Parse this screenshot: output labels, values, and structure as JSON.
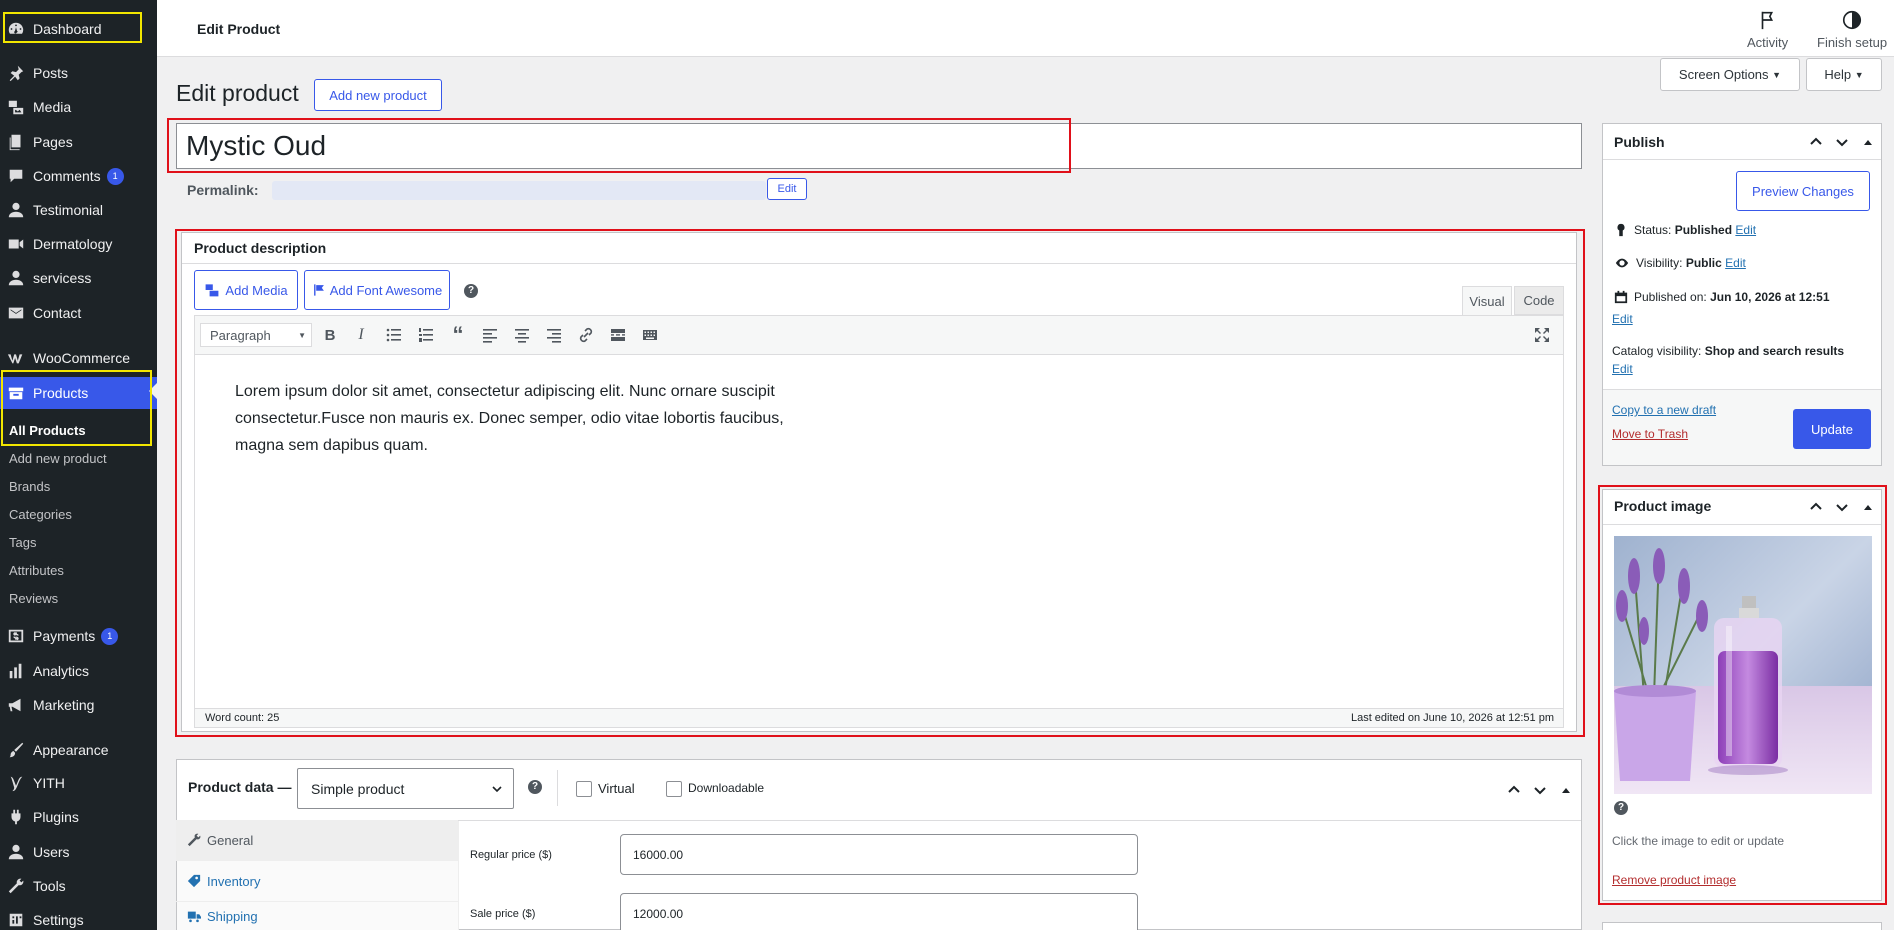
{
  "sidebar": {
    "items": [
      {
        "label": "Dashboard",
        "icon": "dashboard-icon"
      },
      {
        "label": "Posts",
        "icon": "pin-icon"
      },
      {
        "label": "Media",
        "icon": "media-icon"
      },
      {
        "label": "Pages",
        "icon": "pages-icon"
      },
      {
        "label": "Comments",
        "icon": "comment-icon",
        "badge": "1"
      },
      {
        "label": "Testimonial",
        "icon": "user-icon"
      },
      {
        "label": "Dermatology",
        "icon": "video-icon"
      },
      {
        "label": "servicess",
        "icon": "user-icon"
      },
      {
        "label": "Contact",
        "icon": "mail-icon"
      },
      {
        "label": "WooCommerce",
        "icon": "woo-icon"
      },
      {
        "label": "Products",
        "icon": "archive-icon"
      },
      {
        "label": "Payments",
        "icon": "dollar-icon",
        "badge": "1"
      },
      {
        "label": "Analytics",
        "icon": "bar-chart-icon"
      },
      {
        "label": "Marketing",
        "icon": "megaphone-icon"
      },
      {
        "label": "Appearance",
        "icon": "brush-icon"
      },
      {
        "label": "YITH",
        "icon": "yith-icon"
      },
      {
        "label": "Plugins",
        "icon": "plugin-icon"
      },
      {
        "label": "Users",
        "icon": "user-icon"
      },
      {
        "label": "Tools",
        "icon": "wrench-icon"
      },
      {
        "label": "Settings",
        "icon": "settings-icon"
      }
    ],
    "submenu": [
      "All Products",
      "Add new product",
      "Brands",
      "Categories",
      "Tags",
      "Attributes",
      "Reviews"
    ]
  },
  "topbar": {
    "page_header": "Edit Product",
    "activity": "Activity",
    "finish_setup": "Finish setup",
    "screen_options": "Screen Options",
    "help": "Help"
  },
  "main": {
    "heading": "Edit product",
    "add_new": "Add new product",
    "title_value": "Mystic Oud",
    "permalink_label": "Permalink:",
    "permalink_edit": "Edit"
  },
  "editor": {
    "box_title": "Product description",
    "add_media": "Add Media",
    "add_font_awesome": "Add Font Awesome",
    "tab_visual": "Visual",
    "tab_code": "Code",
    "format_select": "Paragraph",
    "content": "Lorem ipsum dolor sit amet, consectetur adipiscing elit. Nunc ornare suscipit consectetur.Fusce non mauris ex. Donec semper, odio vitae lobortis faucibus, magna sem dapibus quam.",
    "word_count": "Word count: 25",
    "last_edited": "Last edited on June 10, 2026 at 12:51 pm"
  },
  "publish": {
    "title": "Publish",
    "preview": "Preview Changes",
    "status_label": "Status:",
    "status_value": "Published",
    "visibility_label": "Visibility:",
    "visibility_value": "Public",
    "published_label": "Published on:",
    "published_value": "Jun 10, 2026 at 12:51",
    "catalog_label": "Catalog visibility:",
    "catalog_value": "Shop and search results",
    "edit": "Edit",
    "copy_draft": "Copy to a new draft",
    "trash": "Move to Trash",
    "update": "Update"
  },
  "product_image": {
    "title": "Product image",
    "hint": "Click the image to edit or update",
    "remove": "Remove product image"
  },
  "product_data": {
    "label": "Product data —",
    "type": "Simple product",
    "virtual": "Virtual",
    "downloadable": "Downloadable",
    "tabs": [
      "General",
      "Inventory",
      "Shipping"
    ],
    "regular_price_label": "Regular price ($)",
    "regular_price": "16000.00",
    "sale_price_label": "Sale price ($)",
    "sale_price": "12000.00"
  },
  "colors": {
    "accent": "#3858e9",
    "sidebar_bg": "#1d2327",
    "highlight_red": "#e0101a",
    "highlight_yellow": "#f2e600"
  }
}
